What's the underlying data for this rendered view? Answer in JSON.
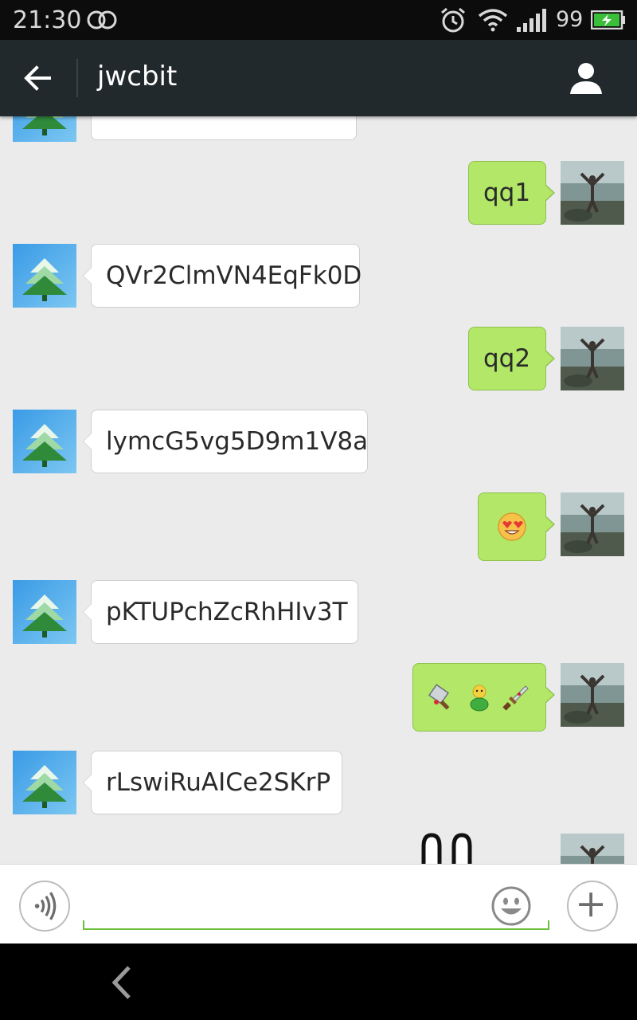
{
  "status_bar": {
    "time": "21:30",
    "battery_level": "99",
    "icons": [
      "dual-sim-icon",
      "alarm-icon",
      "wifi-icon",
      "signal-icon",
      "battery-charging-icon"
    ]
  },
  "header": {
    "title": "jwcbit",
    "back_icon": "arrow-left-icon",
    "profile_icon": "person-icon",
    "colors": {
      "background": "#22292c",
      "title": "#ffffff"
    }
  },
  "chat": {
    "background": "#ebebeb",
    "incoming_bubble_color": "#ffffff",
    "outgoing_bubble_color": "#b2e768",
    "messages": [
      {
        "side": "left",
        "kind": "text",
        "text": "",
        "note_partial": true
      },
      {
        "side": "right",
        "kind": "text",
        "text": "qq1"
      },
      {
        "side": "left",
        "kind": "text",
        "text": "QVr2ClmVN4EqFk0D"
      },
      {
        "side": "right",
        "kind": "text",
        "text": "qq2"
      },
      {
        "side": "left",
        "kind": "text",
        "text": "lymcG5vg5D9m1V8a"
      },
      {
        "side": "right",
        "kind": "emoji",
        "emojis": [
          "heart-eyes-emoji"
        ]
      },
      {
        "side": "left",
        "kind": "text",
        "text": "pKTUPchZcRhHIv3T"
      },
      {
        "side": "right",
        "kind": "emoji",
        "emojis": [
          "cleaver-emoji",
          "green-figure-emoji",
          "dagger-emoji"
        ]
      },
      {
        "side": "left",
        "kind": "text",
        "text": "rLswiRuAICe2SKrP"
      },
      {
        "side": "right",
        "kind": "sticker",
        "emojis": [
          "bunny-ears-sticker"
        ]
      }
    ]
  },
  "input_bar": {
    "value": "",
    "placeholder": "",
    "voice_icon": "voice-icon",
    "emoji_icon": "smiley-icon",
    "more_icon": "plus-icon",
    "accent": "#6dbf3a"
  },
  "nav_bar": {
    "back_icon": "nav-back-icon"
  }
}
